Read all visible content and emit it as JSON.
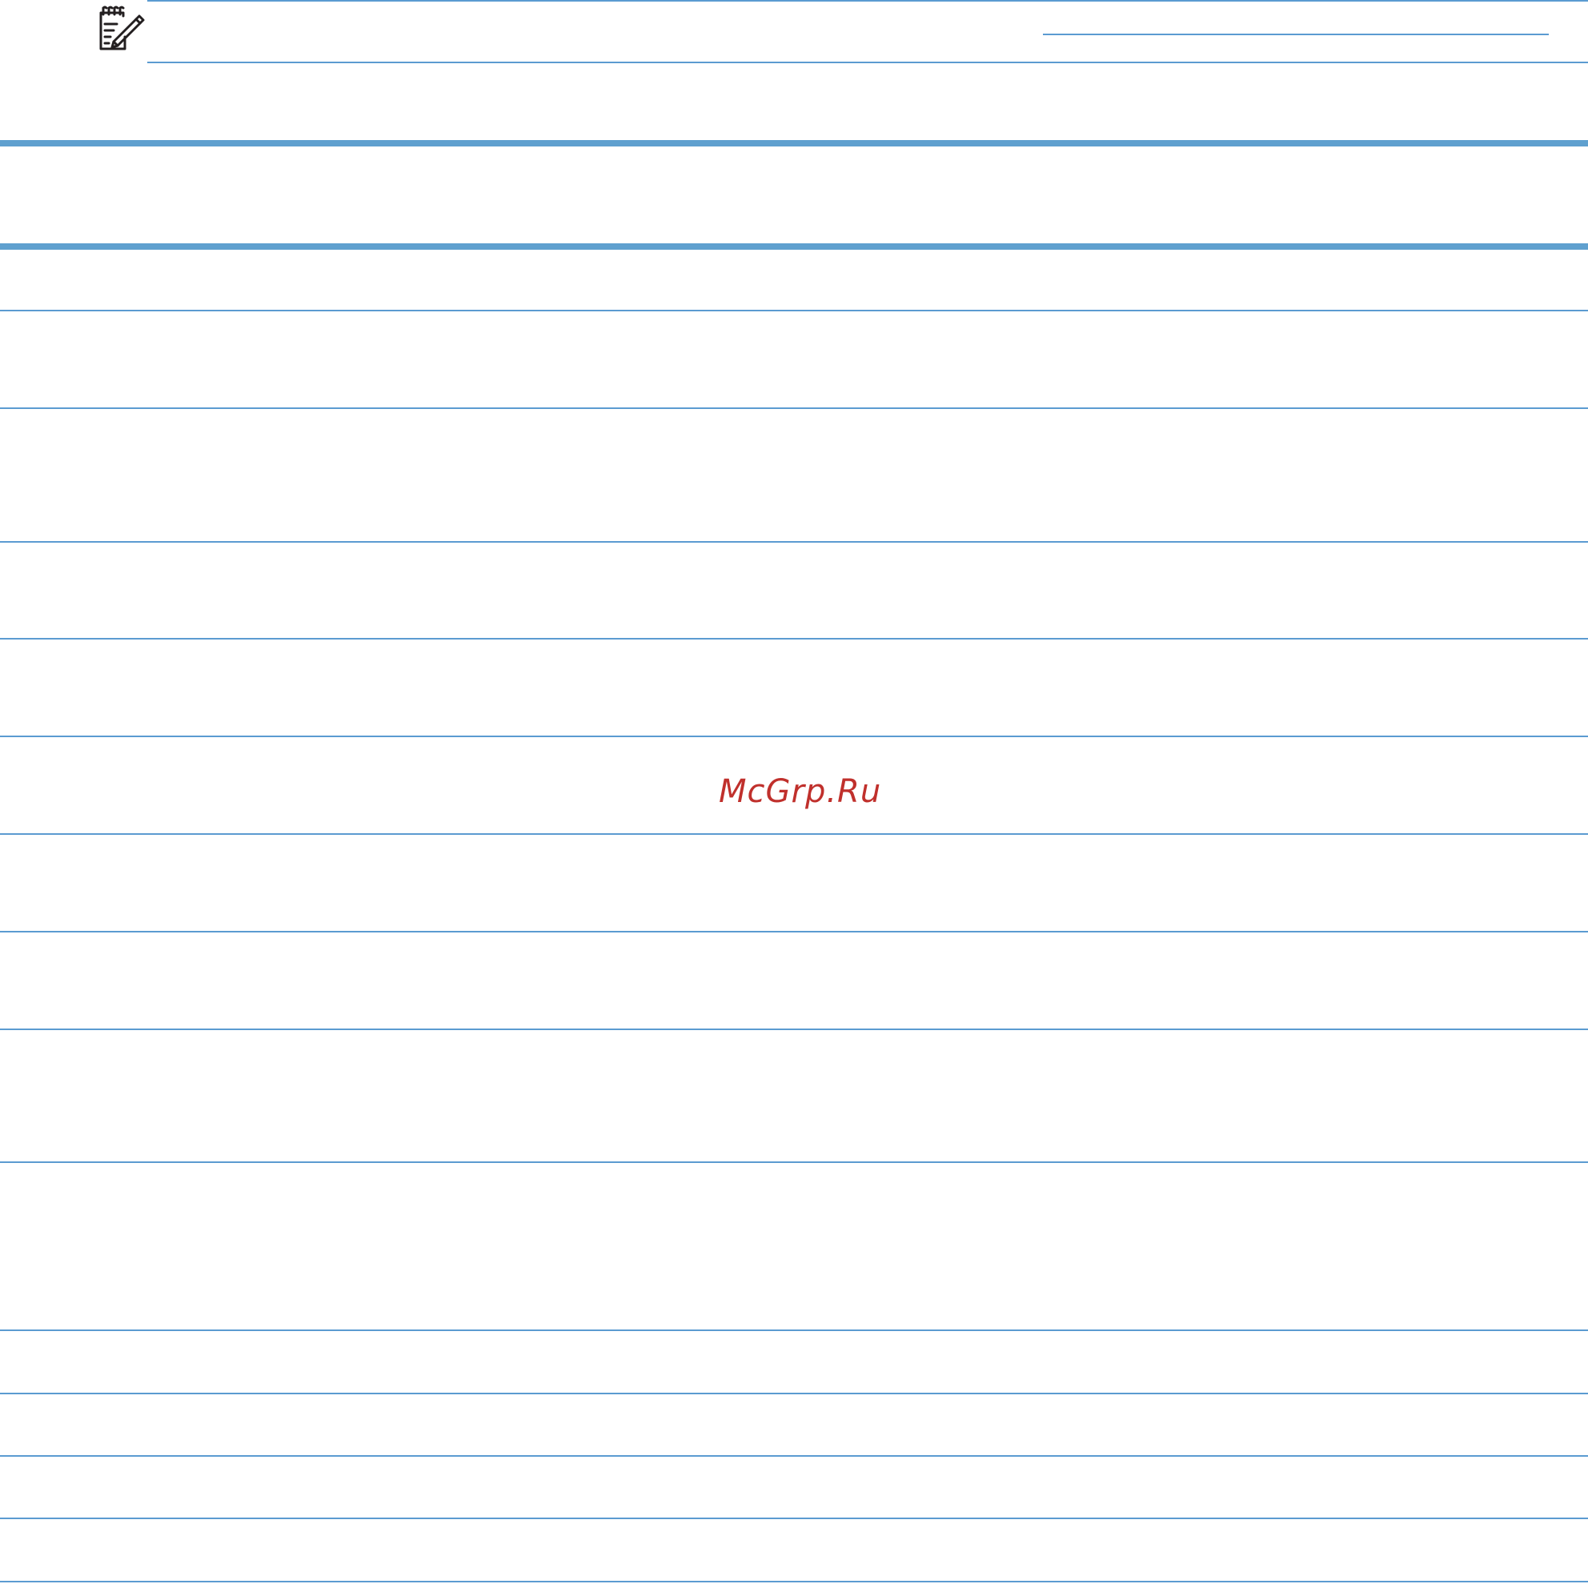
{
  "note": {
    "icon": "note-pencil-icon"
  },
  "watermark": {
    "text": "McGrp.Ru"
  },
  "colors": {
    "rule": "#5b9bd1",
    "rule_thick": "#5fa0cf",
    "watermark": "#c0302c",
    "icon": "#231f20"
  }
}
